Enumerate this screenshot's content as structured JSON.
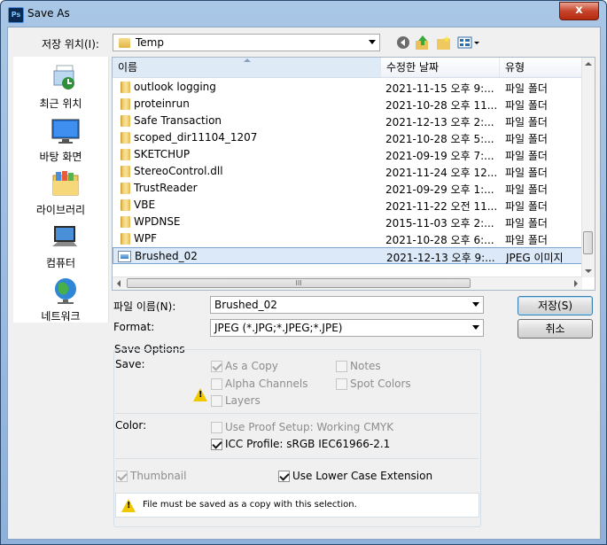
{
  "window": {
    "title": "Save As",
    "app_icon": "Ps",
    "close_label": "x"
  },
  "location": {
    "label": "저장 위치(I):",
    "value": "Temp"
  },
  "places": [
    {
      "label": "최근 위치",
      "icon": "recent-places-icon"
    },
    {
      "label": "바탕 화면",
      "icon": "desktop-icon"
    },
    {
      "label": "라이브러리",
      "icon": "libraries-icon"
    },
    {
      "label": "컴퓨터",
      "icon": "computer-icon"
    },
    {
      "label": "네트워크",
      "icon": "network-icon"
    }
  ],
  "file_list": {
    "columns": {
      "name": "이름",
      "date": "수정한 날짜",
      "type": "유형"
    },
    "rows": [
      {
        "name": "outlook logging",
        "date": "2021-11-15 오후 9:...",
        "type": "파일 폴더",
        "kind": "folder"
      },
      {
        "name": "proteinrun",
        "date": "2021-10-28 오후 11...",
        "type": "파일 폴더",
        "kind": "folder"
      },
      {
        "name": "Safe Transaction",
        "date": "2021-12-13 오후 2:...",
        "type": "파일 폴더",
        "kind": "folder"
      },
      {
        "name": "scoped_dir11104_1207",
        "date": "2021-10-28 오후 5:...",
        "type": "파일 폴더",
        "kind": "folder"
      },
      {
        "name": "SKETCHUP",
        "date": "2021-09-19 오후 7:...",
        "type": "파일 폴더",
        "kind": "folder"
      },
      {
        "name": "StereoControl.dll",
        "date": "2021-11-24 오후 12...",
        "type": "파일 폴더",
        "kind": "folder"
      },
      {
        "name": "TrustReader",
        "date": "2021-09-29 오후 1:...",
        "type": "파일 폴더",
        "kind": "folder"
      },
      {
        "name": "VBE",
        "date": "2021-11-22 오전 11...",
        "type": "파일 폴더",
        "kind": "folder"
      },
      {
        "name": "WPDNSE",
        "date": "2015-11-03 오후 2:...",
        "type": "파일 폴더",
        "kind": "folder"
      },
      {
        "name": "WPF",
        "date": "2021-10-28 오후 6:...",
        "type": "파일 폴더",
        "kind": "folder"
      },
      {
        "name": "Brushed_02",
        "date": "2021-12-13 오후 9:...",
        "type": "JPEG 이미지",
        "kind": "image",
        "selected": true
      }
    ],
    "hscroll_grip": "III"
  },
  "file_name": {
    "label": "파일 이름(N):",
    "value": "Brushed_02"
  },
  "format": {
    "label": "Format:",
    "value": "JPEG (*.JPG;*.JPEG;*.JPE)"
  },
  "buttons": {
    "save": "저장(S)",
    "cancel": "취소"
  },
  "save_options": {
    "title": "Save Options",
    "save_label": "Save:",
    "as_a_copy": {
      "label": "As a Copy",
      "checked": true,
      "enabled": false
    },
    "notes": {
      "label": "Notes",
      "checked": false,
      "enabled": false
    },
    "alpha_channels": {
      "label": "Alpha Channels",
      "checked": false,
      "enabled": false
    },
    "spot_colors": {
      "label": "Spot Colors",
      "checked": false,
      "enabled": false
    },
    "layers": {
      "label": "Layers",
      "checked": false,
      "enabled": false
    },
    "color_label": "Color:",
    "use_proof_setup": {
      "label": "Use Proof Setup:  Working CMYK",
      "checked": false,
      "enabled": false
    },
    "icc_profile": {
      "label": "ICC Profile:  sRGB IEC61966-2.1",
      "checked": true,
      "enabled": true
    },
    "thumbnail": {
      "label": "Thumbnail",
      "checked": true,
      "enabled": false
    },
    "lower_case_extension": {
      "label": "Use Lower Case Extension",
      "checked": true,
      "enabled": true
    },
    "warning_message": "File must be saved as a copy with this selection.",
    "warning_glyph": "!"
  },
  "colors": {
    "title_bar": "#a9c6e6",
    "close_button": "#c7442c",
    "selection": "#dce9f8",
    "warning": "#f0c800"
  }
}
